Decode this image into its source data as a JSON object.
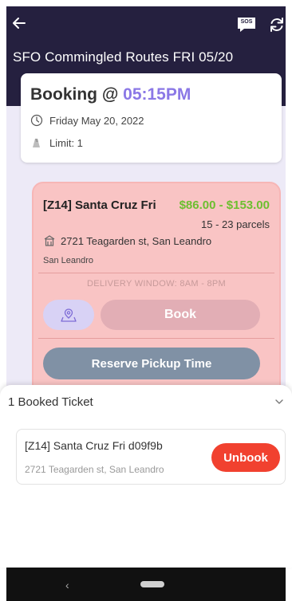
{
  "header": {
    "title": "SFO Commingled Routes FRI 05/20",
    "sos_label": "SOS",
    "icons": [
      "arrow-left-icon",
      "sos-chat-icon",
      "refresh-icon"
    ],
    "background": "#25203f"
  },
  "booking": {
    "label": "Booking @",
    "time": "05:15PM",
    "date": "Friday May 20, 2022",
    "limit": "Limit: 1",
    "accent": "#8b78e6"
  },
  "ticket": {
    "route_name": "[Z14] Santa Cruz Fri",
    "price": "$86.00 - $153.00",
    "parcels": "15 - 23 parcels",
    "address": "2721 Teagarden st, San Leandro",
    "city": "San Leandro",
    "delivery_window": "DELIVERY WINDOW: 8AM - 8PM",
    "book_label": "Book",
    "reserve_label": "Reserve Pickup Time",
    "colors": {
      "background": "#f9c4c4",
      "price": "#6cbf2f",
      "reserve": "#8091a5"
    }
  },
  "sheet": {
    "title": "1 Booked Ticket",
    "booked": {
      "name": "[Z14] Santa Cruz Fri d09f9b",
      "address": "2721 Teagarden st, San Leandro",
      "unbook_label": "Unbook",
      "unbook_color": "#f1412f"
    }
  },
  "nav": {
    "back_glyph": "‹"
  }
}
